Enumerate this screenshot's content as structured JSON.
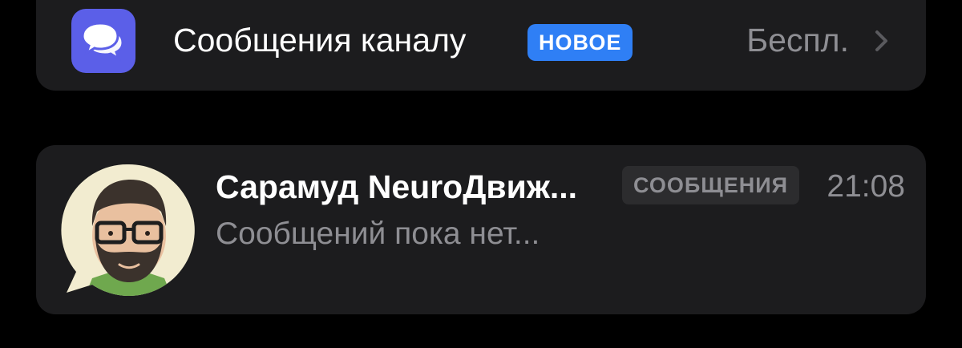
{
  "channel_messages_row": {
    "icon": "speech-bubbles-icon",
    "title": "Сообщения каналу",
    "badge": "НОВОЕ",
    "value": "Беспл.",
    "chevron": "chevron-right-icon"
  },
  "chat_row": {
    "name": "Сарамуд NeuroДвиж...",
    "badge": "СООБЩЕНИЯ",
    "time": "21:08",
    "preview": "Сообщений пока нет..."
  },
  "colors": {
    "background": "#000000",
    "card": "#1c1c1e",
    "accent_blue": "#2f7ff5",
    "icon_purple": "#5b5fe8",
    "secondary_text": "#8e8e93"
  }
}
